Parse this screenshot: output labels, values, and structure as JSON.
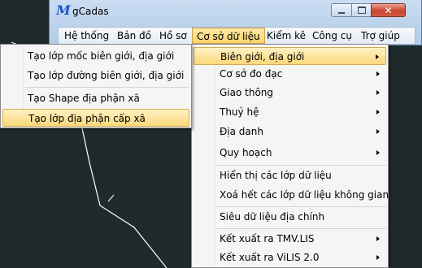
{
  "window": {
    "title": "gCadas",
    "app_icon_glyph": "M",
    "controls": {
      "minimize": "minimize-icon",
      "maximize": "maximize-icon",
      "close": "close-icon",
      "close_glyph": "✕"
    }
  },
  "menubar": {
    "items": [
      {
        "label": "Hệ thống"
      },
      {
        "label": "Bản đồ"
      },
      {
        "label": "Hồ sơ"
      },
      {
        "label": "Cơ sở dữ liệu",
        "active": true
      },
      {
        "label": "Kiểm kê"
      },
      {
        "label": "Công cụ"
      },
      {
        "label": "Trợ giúp"
      }
    ]
  },
  "dropdown": {
    "items": [
      {
        "label": "Biên giới, địa giới",
        "submenu": true,
        "highlighted": true
      },
      {
        "label": "Cơ sở đo đạc",
        "submenu": true
      },
      {
        "label": "Giao thông",
        "submenu": true
      },
      {
        "label": "Thuỷ hệ",
        "submenu": true
      },
      {
        "label": "Địa danh",
        "submenu": true
      },
      {
        "label": "Quy hoạch",
        "submenu": true
      },
      {
        "label": "Hiển thị các lớp dữ liệu"
      },
      {
        "label": "Xoá hết các lớp dữ liệu không gian"
      },
      {
        "label": "Siêu dữ liệu địa chính"
      },
      {
        "label": "Kết xuất ra TMV.LIS",
        "submenu": true
      },
      {
        "label": "Kết xuất ra ViLIS 2.0",
        "submenu": true
      }
    ]
  },
  "submenu": {
    "items": [
      {
        "label": "Tạo lớp mốc biên giới, địa giới"
      },
      {
        "label": "Tạo lớp đường biên giới, địa giới"
      },
      {
        "label": "Tạo Shape địa phận xã"
      },
      {
        "label": "Tạo lớp địa phận cấp xã",
        "highlighted": true
      }
    ]
  },
  "colors": {
    "canvas_bg": "#1f2a2d",
    "highlight": "#fbd87a",
    "title_bar": "#c9dcf2",
    "close_button": "#c74630"
  }
}
